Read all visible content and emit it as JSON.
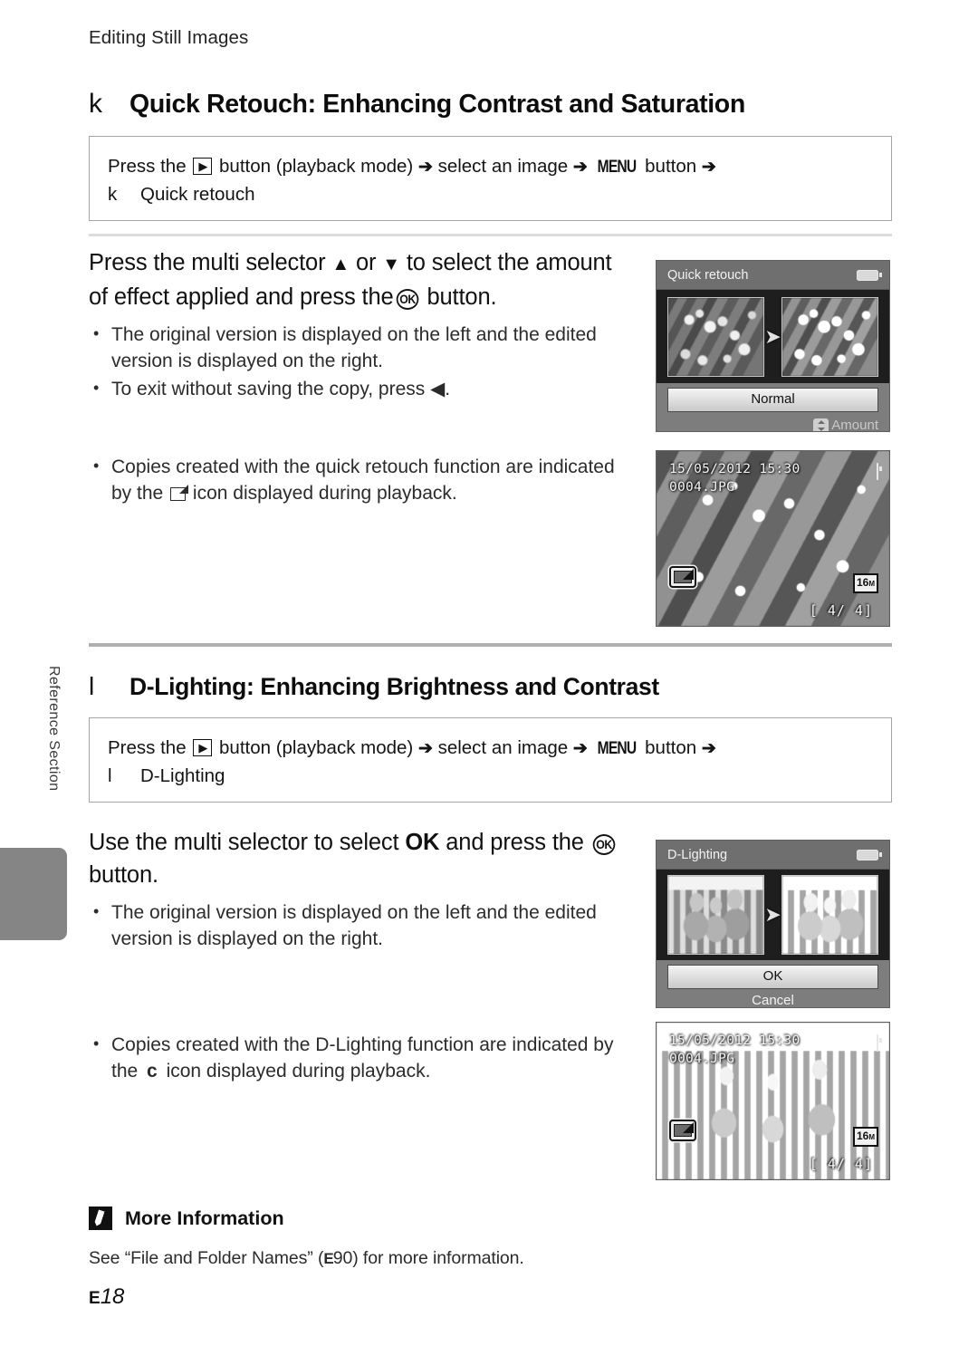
{
  "running_head": "Editing Still Images",
  "side": {
    "label": "Reference Section"
  },
  "sections": [
    {
      "id": "quick-retouch",
      "symbol": "k",
      "heading": "Quick Retouch: Enhancing Contrast and Saturation",
      "procedure": {
        "line1_a": "Press the",
        "line1_play_icon": "playback-icon",
        "line1_b": "button (playback mode)",
        "arrow": "➔",
        "line1_c": "select an image",
        "line1_menu": "MENU",
        "line1_d": "button",
        "line2_symbol": "k",
        "line2_text": "Quick retouch"
      },
      "step_title_parts": {
        "a": "Press the multi selector",
        "up": "▲",
        "or": "or",
        "down": "▼",
        "b": "to select the amount of effect applied and press the",
        "ok": "OK",
        "c": "button."
      },
      "bullets": [
        "The original version is displayed on the left and the edited version is displayed on the right.",
        "To exit without saving the copy, press ◀."
      ],
      "late_bullet_a": "Copies created with the quick retouch function are indicated by the",
      "late_bullet_icon": "quick-retouch-icon",
      "late_bullet_b": "icon displayed during playback."
    },
    {
      "id": "d-lighting",
      "symbol": "l",
      "heading": "D-Lighting: Enhancing Brightness and Contrast",
      "procedure": {
        "line1_a": "Press the",
        "line1_play_icon": "playback-icon",
        "line1_b": "button (playback mode)",
        "arrow": "➔",
        "line1_c": "select an image",
        "line1_menu": "MENU",
        "line1_d": "button",
        "line2_symbol": "l",
        "line2_text": "D-Lighting"
      },
      "step_title_parts": {
        "a": "Use the multi selector to select",
        "ok_word": "OK",
        "b": "and press the",
        "ok": "OK",
        "c": "button."
      },
      "bullets": [
        "The original version is displayed on the left and the edited version is displayed on the right."
      ],
      "late_bullet_a": "Copies created with the D-Lighting function are indicated by the",
      "late_bullet_icon": "d-lighting-icon",
      "late_bullet_icon_glyph": "c",
      "late_bullet_b": "icon displayed during playback."
    }
  ],
  "screens": {
    "quick_retouch_menu": {
      "title": "Quick retouch",
      "battery_icon": "battery-icon",
      "before_thumb": "before-thumbnail",
      "arrow_icon": "arrow-right-icon",
      "after_thumb": "after-thumbnail",
      "option_value": "Normal",
      "amount_label": "Amount",
      "amount_icon": "up-down-selector-icon"
    },
    "playback_flowers": {
      "date": "15/05/2012  15:30",
      "filename": "0004.JPG",
      "battery_icon": "battery-icon",
      "edit_badge_icon": "quick-retouch-badge-icon",
      "image_size": "16",
      "image_size_unit": "M",
      "frame_counter": "[  4/   4]"
    },
    "d_lighting_menu": {
      "title": "D-Lighting",
      "battery_icon": "battery-icon",
      "before_thumb": "before-thumbnail",
      "arrow_icon": "arrow-right-icon",
      "after_thumb": "after-thumbnail",
      "ok_label": "OK",
      "cancel_label": "Cancel"
    },
    "playback_people": {
      "date": "15/05/2012  15:30",
      "filename": "0004.JPG",
      "battery_icon": "battery-icon",
      "edit_badge_icon": "d-lighting-badge-icon",
      "image_size": "16",
      "image_size_unit": "M",
      "frame_counter": "[  4/   4]"
    }
  },
  "more_information": {
    "icon": "pencil-icon",
    "title": "More Information",
    "body_a": "See “File and Folder Names” (",
    "body_ref": "E",
    "body_page": "90",
    "body_b": ") for more information."
  },
  "page_number": {
    "prefix": "E",
    "number": "18"
  }
}
